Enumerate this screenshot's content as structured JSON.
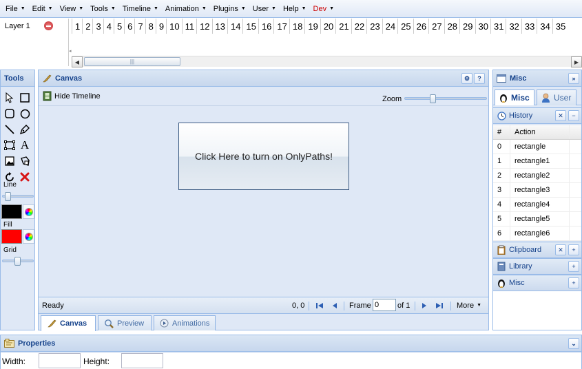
{
  "menubar": {
    "items": [
      {
        "label": "File"
      },
      {
        "label": "Edit"
      },
      {
        "label": "View"
      },
      {
        "label": "Tools"
      },
      {
        "label": "Timeline"
      },
      {
        "label": "Animation"
      },
      {
        "label": "Plugins"
      },
      {
        "label": "User"
      },
      {
        "label": "Help"
      },
      {
        "label": "Dev"
      }
    ]
  },
  "timeline": {
    "layer_name": "Layer 1",
    "frames": [
      "1",
      "2",
      "3",
      "4",
      "5",
      "6",
      "7",
      "8",
      "9",
      "10",
      "11",
      "12",
      "13",
      "14",
      "15",
      "16",
      "17",
      "18",
      "19",
      "20",
      "21",
      "22",
      "23",
      "24",
      "25",
      "26",
      "27",
      "28",
      "29",
      "30",
      "31",
      "32",
      "33",
      "34",
      "35"
    ]
  },
  "tools": {
    "title": "Tools",
    "line_label": "Line",
    "fill_label": "Fill",
    "grid_label": "Grid",
    "line_color": "#000000",
    "fill_color": "#ff0000"
  },
  "canvas": {
    "title": "Canvas",
    "hide_timeline_label": "Hide Timeline",
    "zoom_label": "Zoom",
    "onlypaths_label": "Click Here to turn on OnlyPaths!",
    "status": "Ready",
    "coords": "0, 0",
    "frame_label": "Frame",
    "frame_value": "0",
    "of_label": "of 1",
    "more_label": "More",
    "tabs": [
      {
        "label": "Canvas"
      },
      {
        "label": "Preview"
      },
      {
        "label": "Animations"
      }
    ]
  },
  "misc": {
    "title": "Misc",
    "tabs": [
      {
        "label": "Misc"
      },
      {
        "label": "User"
      }
    ],
    "history": {
      "title": "History",
      "col_num": "#",
      "col_action": "Action",
      "rows": [
        {
          "num": "0",
          "action": "rectangle"
        },
        {
          "num": "1",
          "action": "rectangle1"
        },
        {
          "num": "2",
          "action": "rectangle2"
        },
        {
          "num": "3",
          "action": "rectangle3"
        },
        {
          "num": "4",
          "action": "rectangle4"
        },
        {
          "num": "5",
          "action": "rectangle5"
        },
        {
          "num": "6",
          "action": "rectangle6"
        }
      ]
    },
    "clipboard_title": "Clipboard",
    "library_title": "Library",
    "misc_section_title": "Misc"
  },
  "properties": {
    "title": "Properties",
    "width_label": "Width:",
    "height_label": "Height:",
    "width_value": "",
    "height_value": ""
  }
}
